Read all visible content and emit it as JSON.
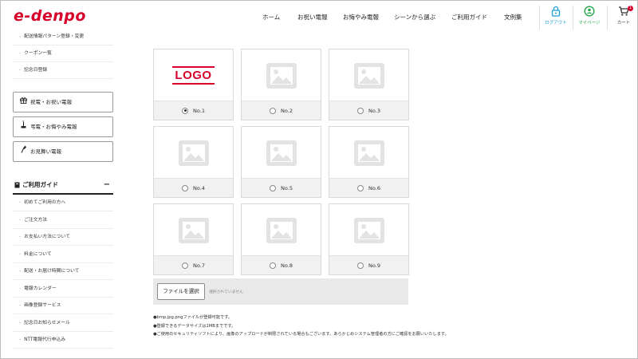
{
  "header": {
    "logo": "e-denpo",
    "nav": [
      "ホーム",
      "お祝い電報",
      "お悔やみ電報",
      "シーンから選ぶ",
      "ご利用ガイド",
      "文例集"
    ],
    "utils": [
      {
        "label": "ログアウト",
        "icon": "lock-open-icon",
        "color": "#1a9fd8"
      },
      {
        "label": "マイページ",
        "icon": "user-circle-icon",
        "color": "#2aa84a"
      },
      {
        "label": "カート",
        "icon": "cart-icon",
        "color": "#333333",
        "badge": "1"
      }
    ]
  },
  "sidebar": {
    "top_links": [
      "配送情報パターン登録・変更",
      "クーポン一覧",
      "記念日登録"
    ],
    "buttons": [
      "祝電・お祝い電報",
      "弔電・お悔やみ電報",
      "お見舞い電報"
    ],
    "guide_title": "ご利用ガイド",
    "guide_toggle": "−",
    "guide_links": [
      "初めてご利用の方へ",
      "ご注文方法",
      "お支払い方法について",
      "料金について",
      "配送・お届け時間について",
      "電報カレンダー",
      "画像登録サービス",
      "記念日お知らせメール",
      "NTT電報代行申込み"
    ]
  },
  "grid": {
    "logo_text": "LOGO",
    "selected_index": 0,
    "items": [
      "No.1",
      "No.2",
      "No.3",
      "No.4",
      "No.5",
      "No.6",
      "No.7",
      "No.8",
      "No.9"
    ]
  },
  "upload": {
    "button_label": "ファイルを選択",
    "status": "選択されていません"
  },
  "notes": [
    "●bmp,jpg,pngファイルが登録可能です。",
    "●登録できるデータサイズは1MBまでです。",
    "●ご使用のセキュリティソフトにより、画像のアップロードが制限されている場合もございます。あらかじめシステム管理者の方にご確認をお願いいたします。"
  ],
  "colors": {
    "brand": "#d7002a",
    "placeholder": "#e3e3e3"
  }
}
